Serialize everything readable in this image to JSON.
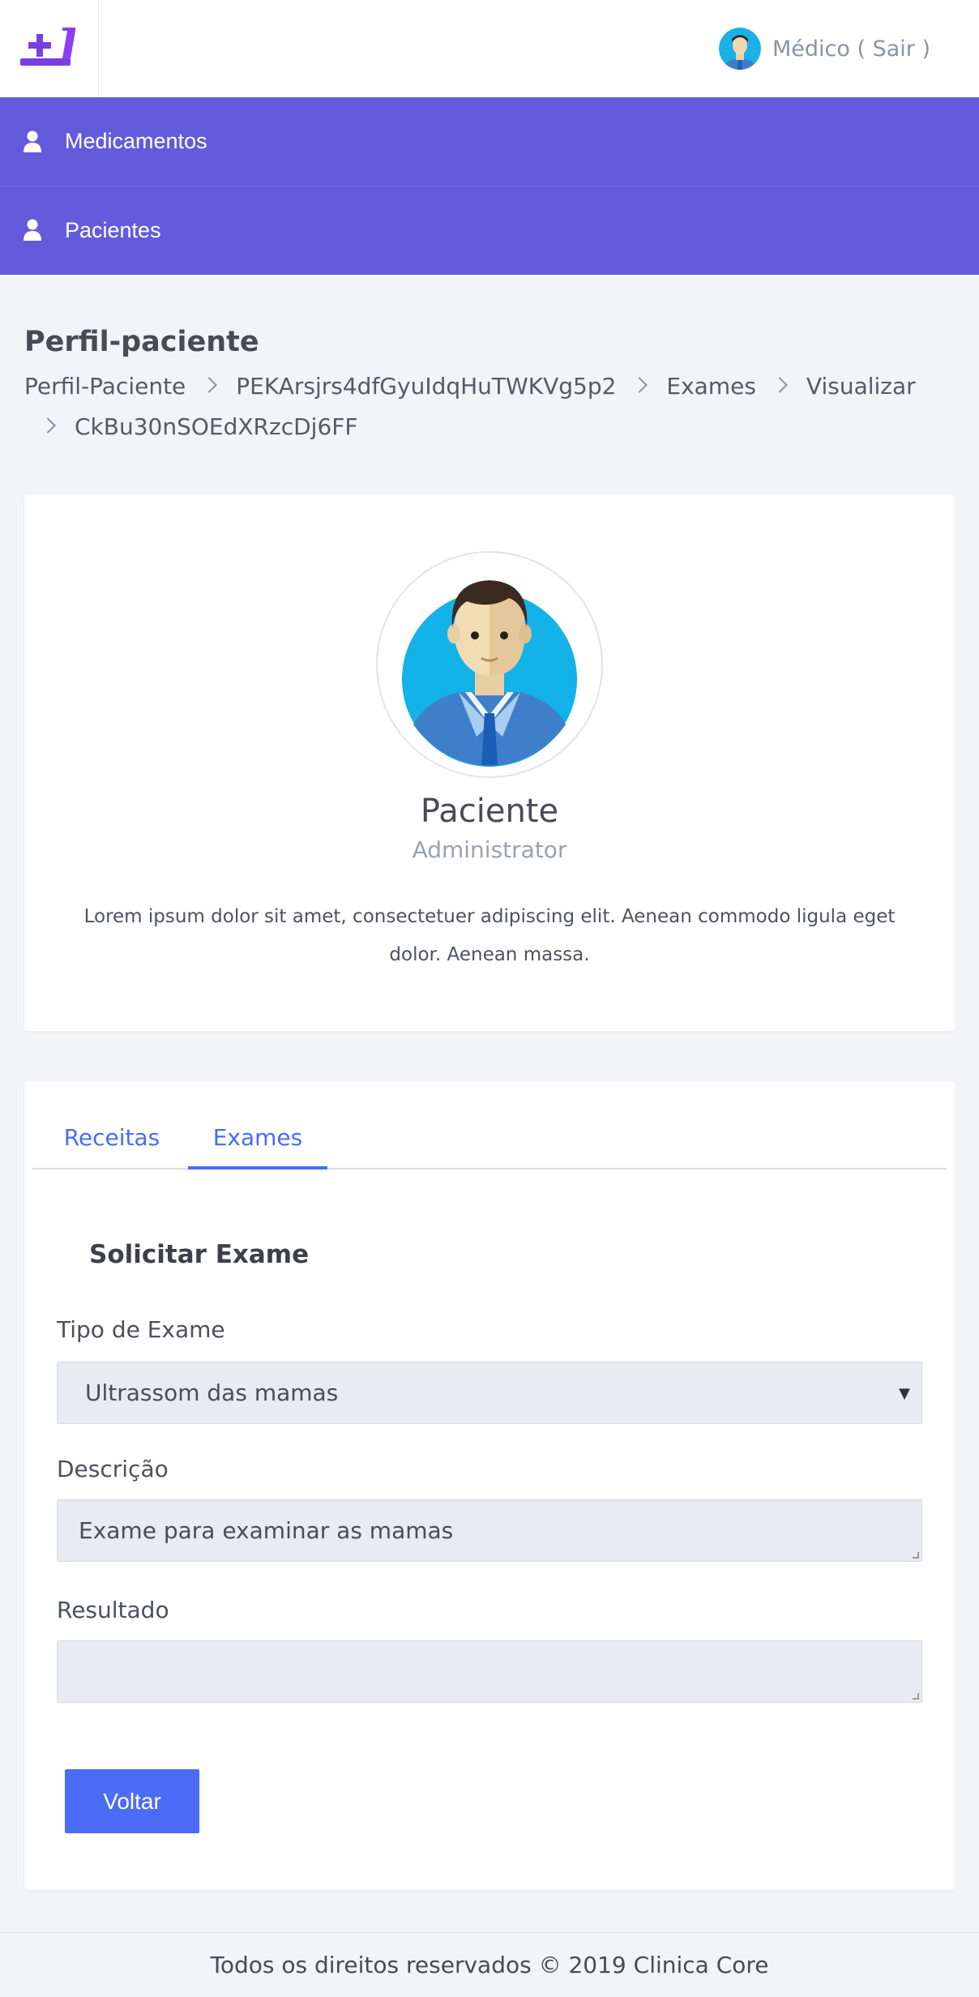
{
  "header": {
    "user_label": "Médico ( Sair )"
  },
  "menu": {
    "items": [
      {
        "label": "Medicamentos"
      },
      {
        "label": "Pacientes"
      }
    ]
  },
  "page": {
    "title": "Perfil-paciente",
    "breadcrumb": [
      "Perfil-Paciente",
      "PEKArsjrs4dfGyuIdqHuTWKVg5p2",
      "Exames",
      "Visualizar",
      "CkBu30nSOEdXRzcDj6FF"
    ]
  },
  "profile": {
    "name": "Paciente",
    "role": "Administrator",
    "description": "Lorem ipsum dolor sit amet, consectetuer adipiscing elit. Aenean commodo ligula eget dolor. Aenean massa."
  },
  "tabs": [
    {
      "label": "Receitas"
    },
    {
      "label": "Exames",
      "active": true
    }
  ],
  "form": {
    "title": "Solicitar Exame",
    "exam_type_label": "Tipo de Exame",
    "exam_type_value": "Ultrassom das mamas",
    "description_label": "Descrição",
    "description_value": "Exame para examinar as mamas",
    "result_label": "Resultado",
    "result_value": "",
    "back_button": "Voltar"
  },
  "footer": {
    "text": "Todos os direitos reservados © 2019 Clinica Core"
  },
  "colors": {
    "brand_purple": "#635bdc",
    "accent_blue": "#4a6cf7",
    "page_bg": "#f3f4f7"
  }
}
